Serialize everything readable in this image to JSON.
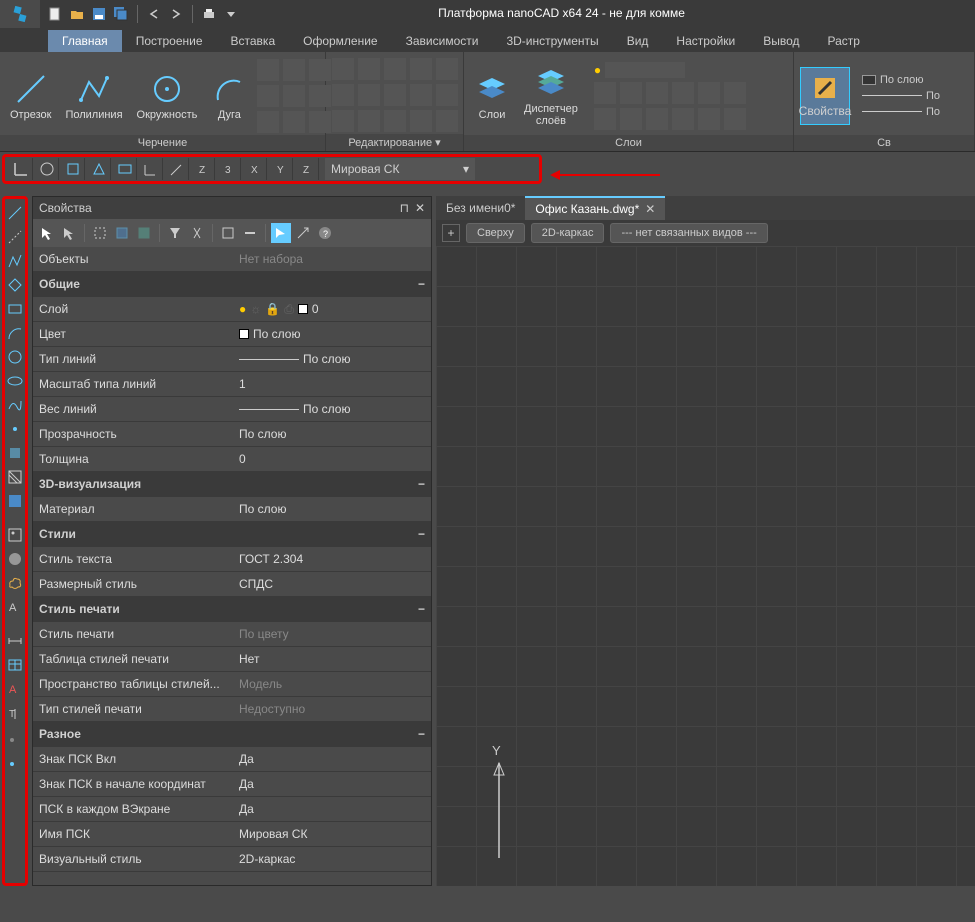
{
  "app": {
    "title": "Платформа nanoCAD x64 24 - не для комме"
  },
  "tabs": [
    "Главная",
    "Построение",
    "Вставка",
    "Оформление",
    "Зависимости",
    "3D-инструменты",
    "Вид",
    "Настройки",
    "Вывод",
    "Растр"
  ],
  "ribbon": {
    "draw": {
      "segment": "Отрезок",
      "polyline": "Полилиния",
      "circle": "Окружность",
      "arc": "Дуга",
      "label": "Черчение"
    },
    "edit": {
      "label": "Редактирование ▾"
    },
    "layers": {
      "layers_btn": "Слои",
      "manager": "Диспетчер\nслоёв",
      "label": "Слои"
    },
    "props": {
      "btn": "Свойства",
      "bylayer": "По слою",
      "line_bylayer": "По",
      "label": "Св"
    }
  },
  "ucs": {
    "combo": "Мировая СК"
  },
  "properties": {
    "title": "Свойства",
    "objects": {
      "k": "Объекты",
      "v": "Нет набора"
    },
    "groups": {
      "general": "Общие",
      "viz3d": "3D-визуализация",
      "styles": "Стили",
      "print": "Стиль печати",
      "misc": "Разное"
    },
    "rows": {
      "layer": {
        "k": "Слой",
        "v": "0"
      },
      "color": {
        "k": "Цвет",
        "v": "По слою"
      },
      "ltype": {
        "k": "Тип линий",
        "v": "По слою"
      },
      "ltscale": {
        "k": "Масштаб типа линий",
        "v": "1"
      },
      "lweight": {
        "k": "Вес линий",
        "v": "По слою"
      },
      "transp": {
        "k": "Прозрачность",
        "v": "По слою"
      },
      "thick": {
        "k": "Толщина",
        "v": "0"
      },
      "material": {
        "k": "Материал",
        "v": "По слою"
      },
      "tstyle": {
        "k": "Стиль текста",
        "v": "ГОСТ 2.304"
      },
      "dstyle": {
        "k": "Размерный стиль",
        "v": "СПДС"
      },
      "pstyle": {
        "k": "Стиль печати",
        "v": "По цвету"
      },
      "ptable": {
        "k": "Таблица стилей печати",
        "v": "Нет"
      },
      "pspace": {
        "k": "Пространство таблицы стилей...",
        "v": "Модель"
      },
      "ptype": {
        "k": "Тип стилей печати",
        "v": "Недоступно"
      },
      "ucs_on": {
        "k": "Знак ПСК Вкл",
        "v": "Да"
      },
      "ucs_origin": {
        "k": "Знак ПСК в начале координат",
        "v": "Да"
      },
      "ucs_vp": {
        "k": "ПСК в каждом ВЭкране",
        "v": "Да"
      },
      "ucs_name": {
        "k": "Имя ПСК",
        "v": "Мировая СК"
      },
      "vstyle": {
        "k": "Визуальный стиль",
        "v": "2D-каркас"
      }
    }
  },
  "docs": {
    "tab1": "Без имени0*",
    "tab2": "Офис Казань.dwg*",
    "view_top": "Сверху",
    "view_wire": "2D-каркас",
    "view_linked": "--- нет связанных видов ---"
  }
}
